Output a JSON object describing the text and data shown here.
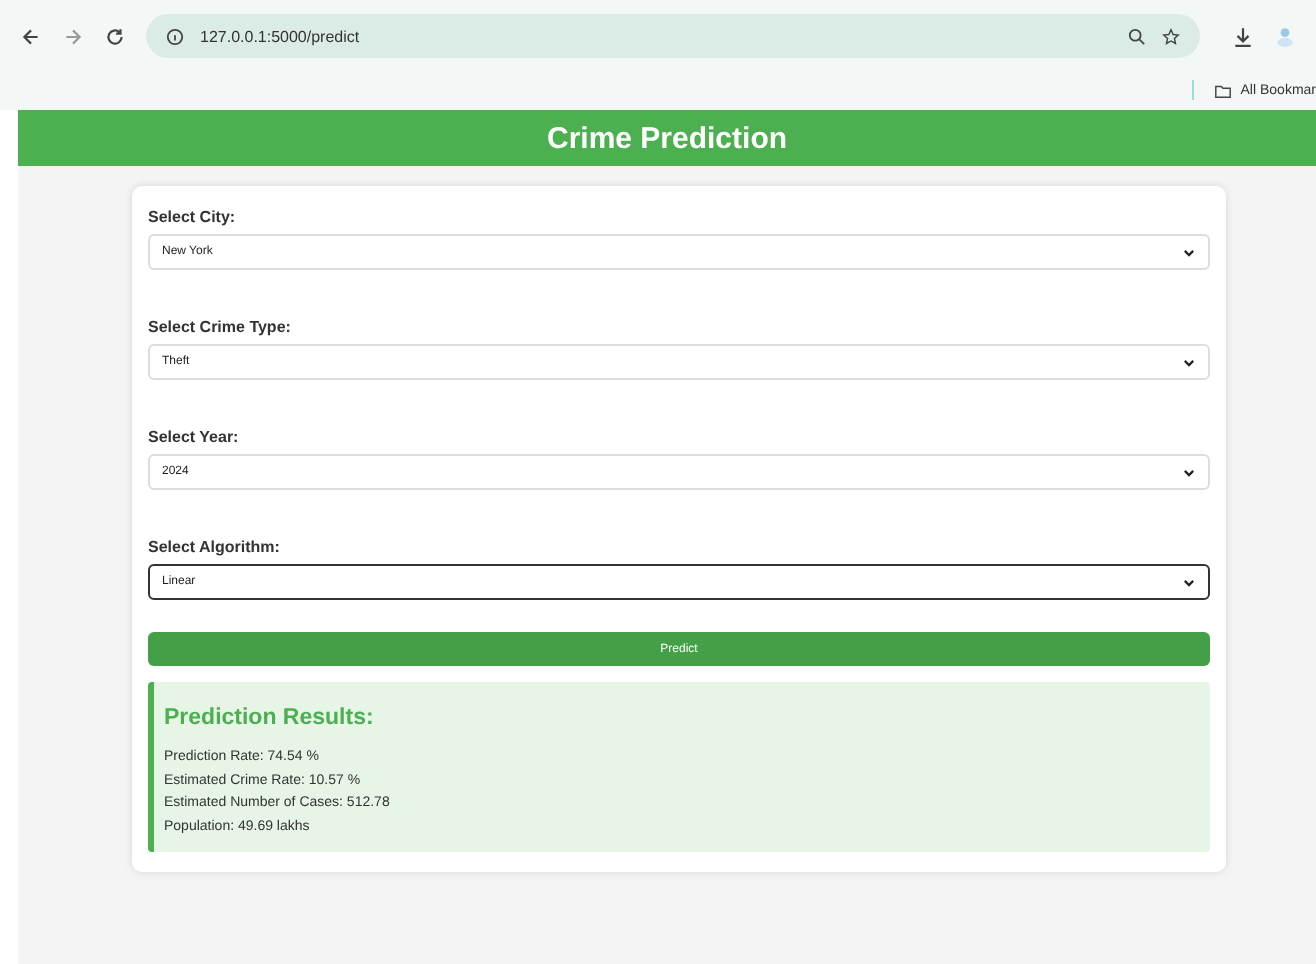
{
  "browser": {
    "url": "127.0.0.1:5000/predict",
    "bookmarks_label": "All Bookmar"
  },
  "header": {
    "title": "Crime Prediction"
  },
  "form": {
    "fields": [
      {
        "label": "Select City:",
        "value": "New York",
        "focused": false
      },
      {
        "label": "Select Crime Type:",
        "value": "Theft",
        "focused": false
      },
      {
        "label": "Select Year:",
        "value": "2024",
        "focused": false
      },
      {
        "label": "Select Algorithm:",
        "value": "Linear",
        "focused": true
      }
    ],
    "submit": "Predict"
  },
  "results": {
    "title": "Prediction Results:",
    "lines": [
      "Prediction Rate: 74.54 %",
      "Estimated Crime Rate: 10.57 %",
      "Estimated Number of Cases: 512.78",
      "Population: 49.69 lakhs"
    ]
  }
}
